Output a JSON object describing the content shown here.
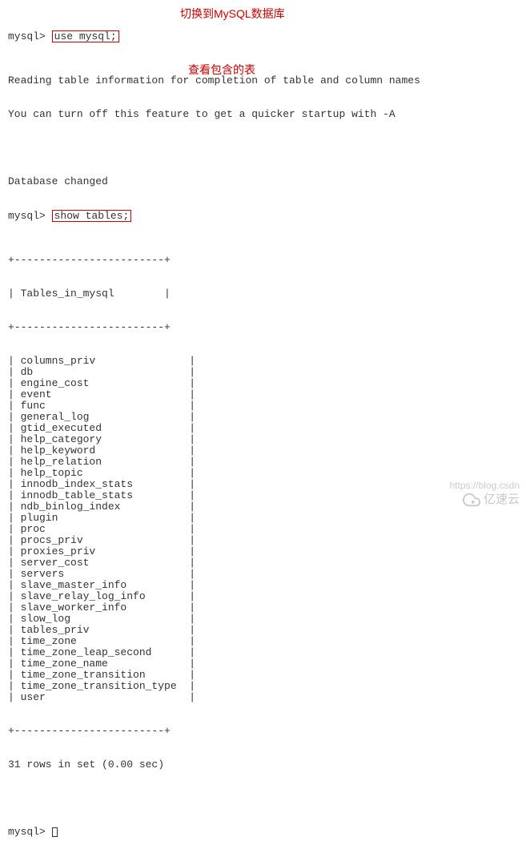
{
  "prompt": "mysql>",
  "cmd1": "use mysql;",
  "annotation1": "切换到MySQL数据库",
  "msg1": "Reading table information for completion of table and column names",
  "msg2": "You can turn off this feature to get a quicker startup with -A",
  "msg3": "Database changed",
  "cmd2": "show tables;",
  "annotation2": "查看包含的表",
  "border_top": "+------------------------+",
  "header": "| Tables_in_mysql        |",
  "border_mid": "+------------------------+",
  "tables": [
    "columns_priv",
    "db",
    "engine_cost",
    "event",
    "func",
    "general_log",
    "gtid_executed",
    "help_category",
    "help_keyword",
    "help_relation",
    "help_topic",
    "innodb_index_stats",
    "innodb_table_stats",
    "ndb_binlog_index",
    "plugin",
    "proc",
    "procs_priv",
    "proxies_priv",
    "server_cost",
    "servers",
    "slave_master_info",
    "slave_relay_log_info",
    "slave_worker_info",
    "slow_log",
    "tables_priv",
    "time_zone",
    "time_zone_leap_second",
    "time_zone_name",
    "time_zone_transition",
    "time_zone_transition_type",
    "user"
  ],
  "border_bot": "+------------------------+",
  "result": "31 rows in set (0.00 sec)",
  "watermark_text": "亿速云",
  "watermark_url": "https://blog.csdn"
}
